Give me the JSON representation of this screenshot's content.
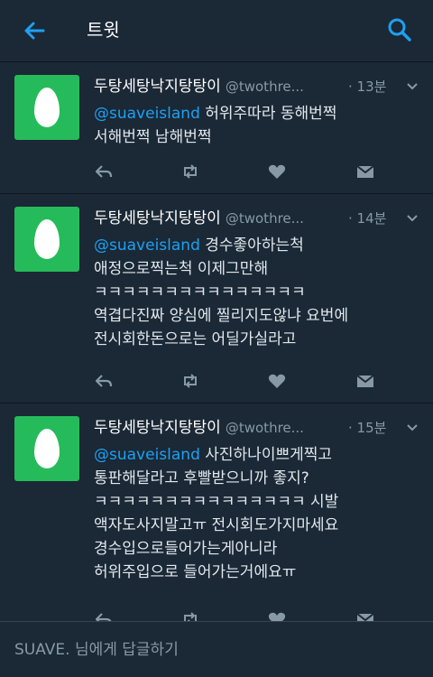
{
  "header": {
    "title": "트윗"
  },
  "tweets": [
    {
      "author": "두탕세탕낙지탕탕이",
      "handle": "@twothre...",
      "time": "· 13분",
      "mention": "@suaveisland",
      "lines": [
        "허위주따라 동해번쩍",
        "서해번쩍 남해번쩍"
      ]
    },
    {
      "author": "두탕세탕낙지탕탕이",
      "handle": "@twothre...",
      "time": "· 14분",
      "mention": "@suaveisland",
      "lines": [
        "경수좋아하는척",
        "애정으로찍는척 이제그만해",
        "ㅋㅋㅋㅋㅋㅋㅋㅋㅋㅋㅋㅋㅋㅋㅋ",
        "역겹다진짜 양심에 찔리지도않냐 요번에",
        "전시회한돈으로는 어딜가실라고"
      ]
    },
    {
      "author": "두탕세탕낙지탕탕이",
      "handle": "@twothre...",
      "time": "· 15분",
      "mention": "@suaveisland",
      "lines": [
        "사진하나이쁘게찍고",
        "통판해달라고 후빨받으니까 좋지?",
        "ㅋㅋㅋㅋㅋㅋㅋㅋㅋㅋㅋㅋㅋㅋㅋ 시발",
        "액자도사지말고ㅠ 전시회도가지마세요",
        "경수입으로들어가는게아니라",
        "허위주입으로 들어가는거에요ㅠ"
      ]
    }
  ],
  "reply_bar": {
    "placeholder": "SUAVE. 님에게 답글하기"
  },
  "icons": [
    "back-arrow-icon",
    "search-icon",
    "caret-down-icon",
    "reply-icon",
    "retweet-icon",
    "like-icon",
    "dm-icon"
  ],
  "colors": {
    "background": "#141d26",
    "card": "#1b2836",
    "accent": "#1da1f2",
    "avatar": "#26bb5a"
  }
}
